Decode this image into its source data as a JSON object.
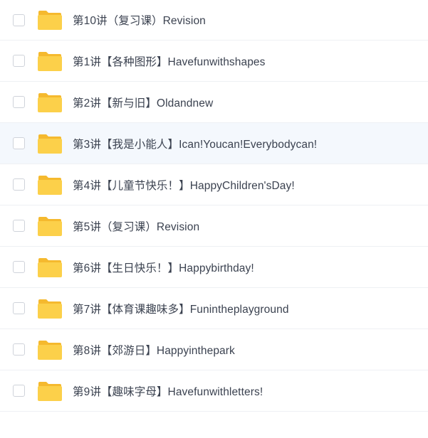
{
  "files": [
    {
      "name": "第10讲（复习课）Revision",
      "type": "folder",
      "selected": false
    },
    {
      "name": "第1讲【各种图形】Havefunwithshapes",
      "type": "folder",
      "selected": false
    },
    {
      "name": "第2讲【新与旧】Oldandnew",
      "type": "folder",
      "selected": false
    },
    {
      "name": "第3讲【我是小能人】Ican!Youcan!Everybodycan!",
      "type": "folder",
      "selected": false
    },
    {
      "name": "第4讲【儿童节快乐！】HappyChildren'sDay!",
      "type": "folder",
      "selected": false
    },
    {
      "name": "第5讲（复习课）Revision",
      "type": "folder",
      "selected": false
    },
    {
      "name": "第6讲【生日快乐！】Happybirthday!",
      "type": "folder",
      "selected": false
    },
    {
      "name": "第7讲【体育课趣味多】Funintheplayground",
      "type": "folder",
      "selected": false
    },
    {
      "name": "第8讲【郊游日】Happyinthepark",
      "type": "folder",
      "selected": false
    },
    {
      "name": "第9讲【趣味字母】Havefunwithletters!",
      "type": "folder",
      "selected": false
    }
  ],
  "colors": {
    "folder_body": "#fcd04a",
    "folder_back": "#f5b92e",
    "text": "#3b4250",
    "hover_row": "#f4f8fd",
    "divider": "#eef0f4"
  },
  "icons": {
    "row_icon": "folder-icon",
    "row_checkbox": "checkbox"
  }
}
